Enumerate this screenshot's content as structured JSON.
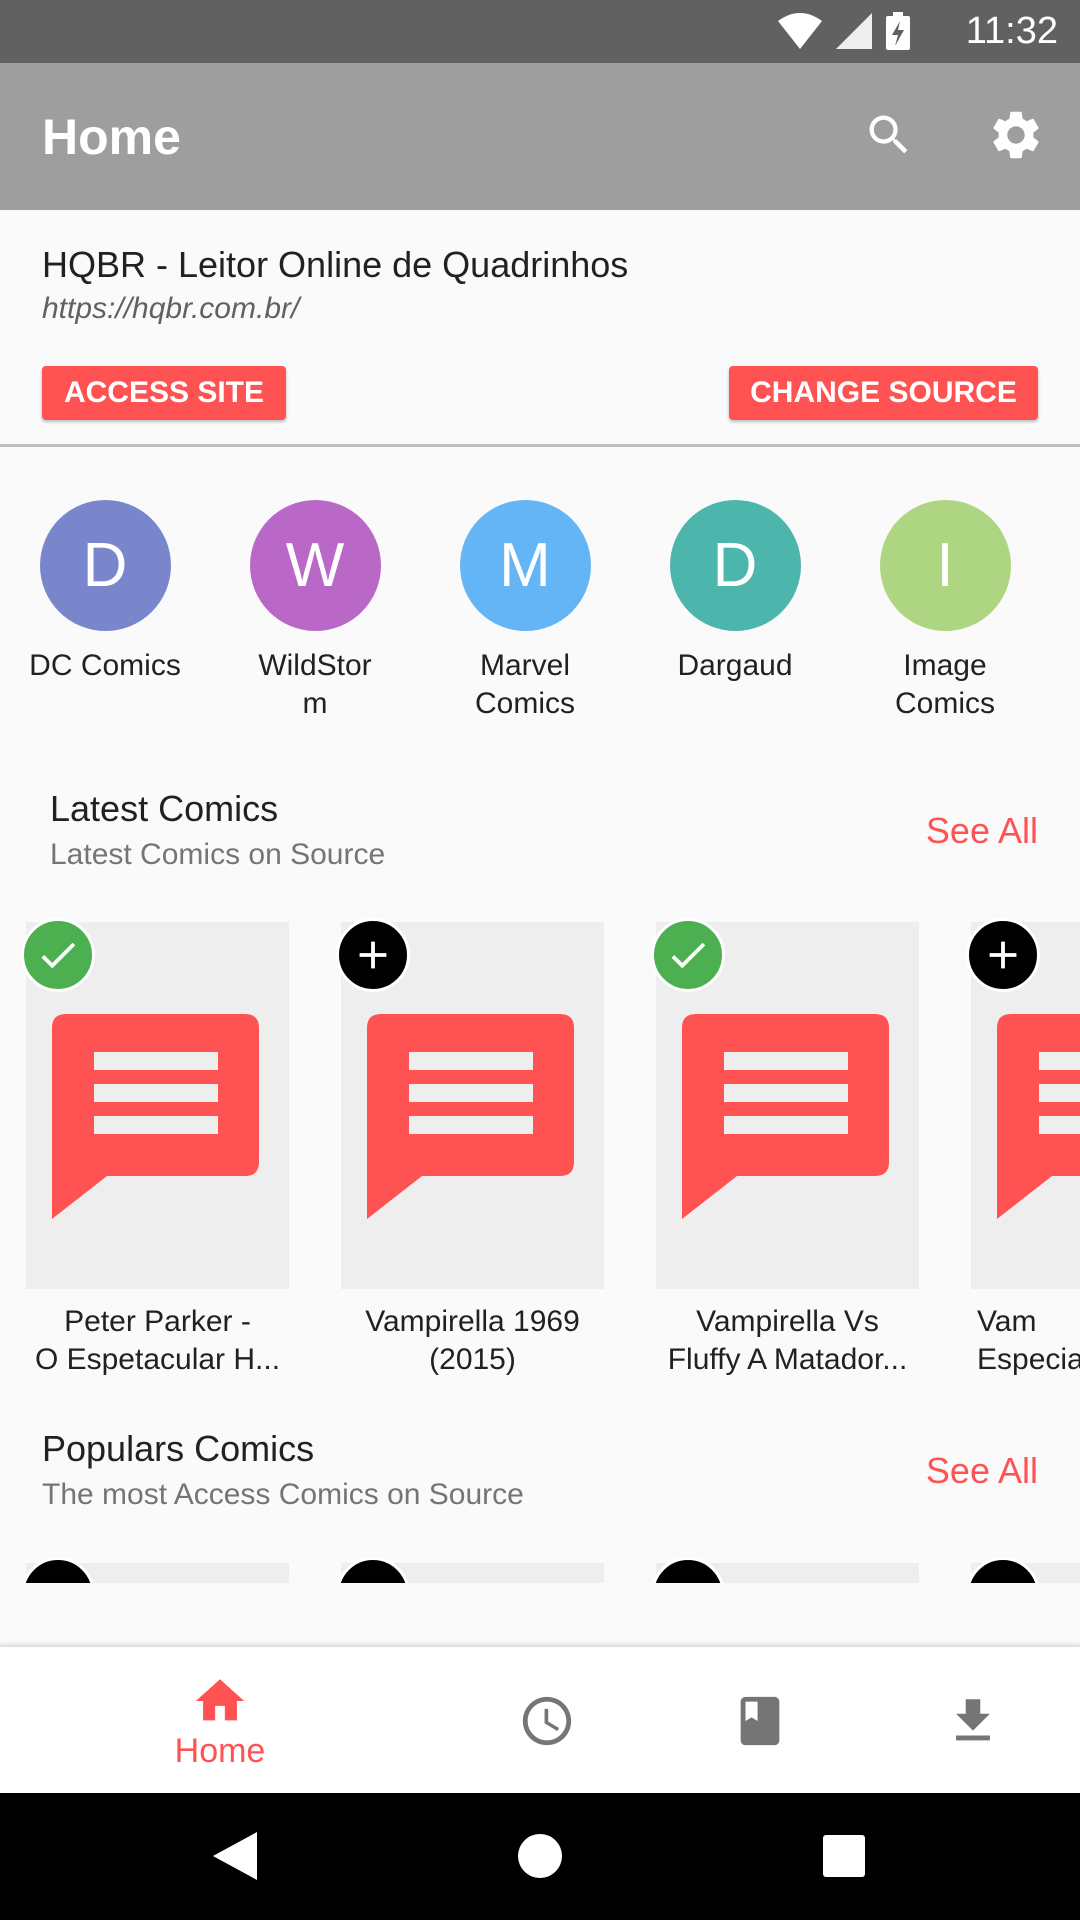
{
  "status_bar": {
    "time": "11:32",
    "icons": [
      "wifi-icon",
      "signal-icon",
      "battery-charging-icon"
    ]
  },
  "app_bar": {
    "title": "Home",
    "actions": [
      "search-icon",
      "settings-icon"
    ]
  },
  "source": {
    "name": "HQBR - Leitor Online de Quadrinhos",
    "url": "https://hqbr.com.br/",
    "access_label": "ACCESS SITE",
    "change_label": "CHANGE SOURCE",
    "accent": "#ff5252"
  },
  "publishers": [
    {
      "letter": "D",
      "name": "DC Comics",
      "color": "#7986cb"
    },
    {
      "letter": "W",
      "name": "WildStor m",
      "color": "#ba68c8"
    },
    {
      "letter": "M",
      "name": "Marvel Comics",
      "color": "#64b5f6"
    },
    {
      "letter": "D",
      "name": "Dargaud",
      "color": "#4db6ac"
    },
    {
      "letter": "I",
      "name": "Image Comics",
      "color": "#aed581"
    }
  ],
  "latest": {
    "title": "Latest Comics",
    "subtitle": "Latest Comics on Source",
    "see_all": "See All",
    "items": [
      {
        "title_line1": "Peter Parker -",
        "title_line2": "O Espetacular H...",
        "status": "check"
      },
      {
        "title_line1": "Vampirella 1969",
        "title_line2": "(2015)",
        "status": "plus"
      },
      {
        "title_line1": "Vampirella Vs",
        "title_line2": "Fluffy A Matador...",
        "status": "check"
      },
      {
        "title_line1": "Vam",
        "title_line2": "Especia",
        "status": "plus"
      }
    ]
  },
  "popular": {
    "title": "Populars Comics",
    "subtitle": "The most Access Comics on Source",
    "see_all": "See All"
  },
  "bottom_nav": {
    "home_label": "Home",
    "items": [
      "home-icon",
      "history-icon",
      "library-icon",
      "download-icon"
    ]
  }
}
